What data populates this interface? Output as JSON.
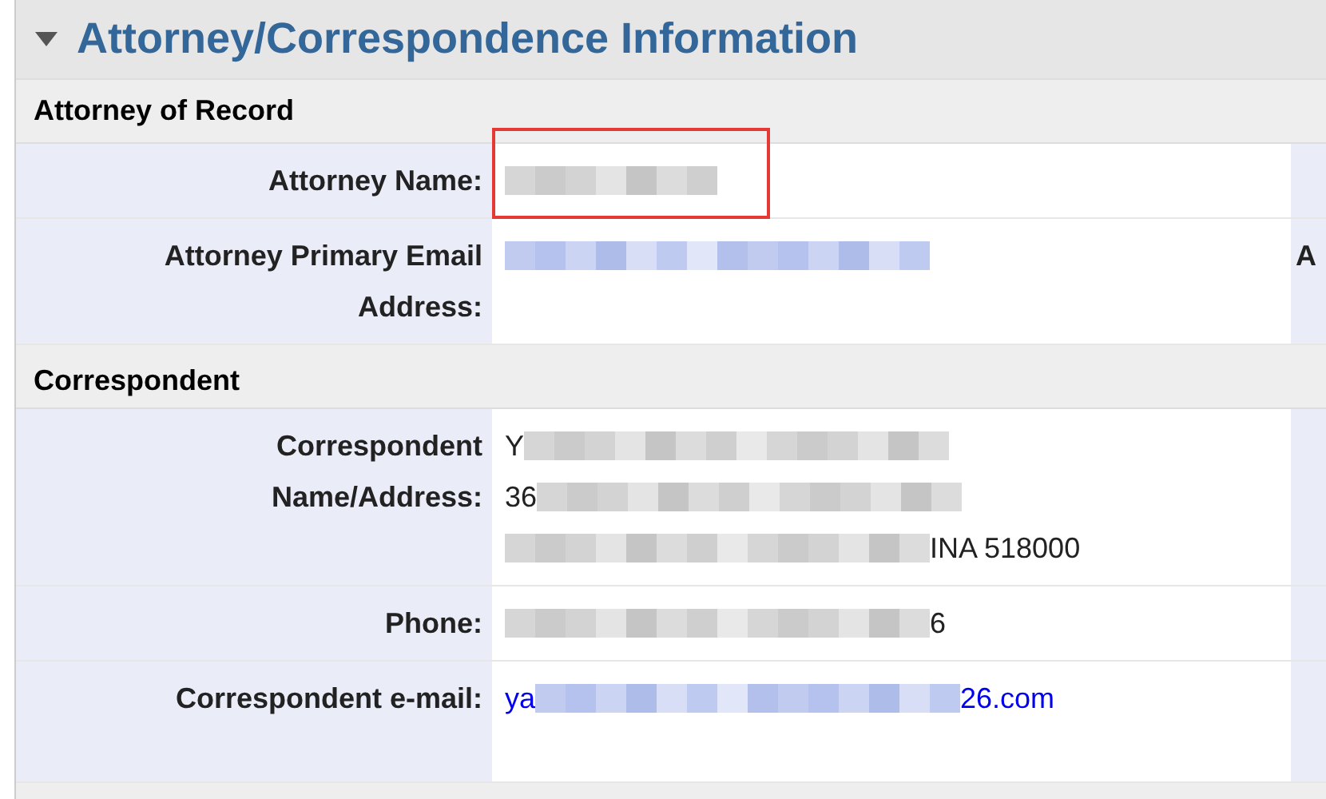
{
  "section": {
    "title": "Attorney/Correspondence Information",
    "expanded": true
  },
  "groups": [
    {
      "title": "Attorney of Record",
      "rows": [
        {
          "label": [
            "Attorney Name:"
          ],
          "highlighted": true,
          "link": false,
          "lines": [
            [
              {
                "kind": "redaction"
              }
            ]
          ]
        },
        {
          "label": [
            "Attorney Primary Email",
            "Address:"
          ],
          "highlighted": false,
          "link": true,
          "lines": [
            [
              {
                "kind": "redaction"
              }
            ]
          ],
          "side_label": "A"
        }
      ]
    },
    {
      "title": "Correspondent",
      "rows": [
        {
          "label": [
            "Correspondent",
            "Name/Address:"
          ],
          "highlighted": false,
          "link": false,
          "lines": [
            [
              {
                "kind": "text",
                "text": "Y"
              },
              {
                "kind": "redaction"
              }
            ],
            [
              {
                "kind": "text",
                "text": "36"
              },
              {
                "kind": "redaction"
              }
            ],
            [
              {
                "kind": "redaction"
              },
              {
                "kind": "text",
                "text": "INA 518000"
              }
            ]
          ]
        },
        {
          "label": [
            "Phone:"
          ],
          "highlighted": false,
          "link": false,
          "lines": [
            [
              {
                "kind": "redaction"
              },
              {
                "kind": "text",
                "text": "6"
              }
            ]
          ]
        },
        {
          "label": [
            "Correspondent e-mail:"
          ],
          "highlighted": false,
          "link": true,
          "lines": [
            [
              {
                "kind": "text",
                "text": "ya"
              },
              {
                "kind": "redaction"
              },
              {
                "kind": "text",
                "text": "26.com"
              }
            ]
          ]
        }
      ]
    }
  ]
}
